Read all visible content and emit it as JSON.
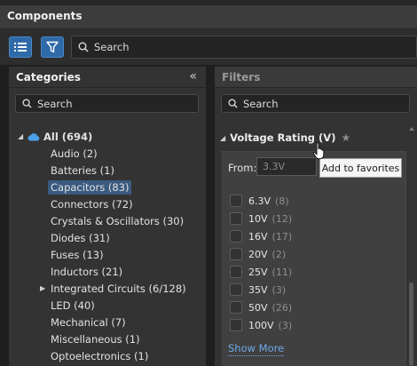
{
  "window": {
    "title": "Components"
  },
  "toolbar": {
    "list_view_icon": "list-icon",
    "filter_icon": "filter-icon",
    "search_placeholder": "Search"
  },
  "categories_panel": {
    "title": "Categories",
    "collapse_glyph": "«",
    "search_placeholder": "Search",
    "root": {
      "label": "All (694)",
      "expanded": true,
      "icon": "cloud-icon"
    },
    "items": [
      {
        "label": "Audio (2)"
      },
      {
        "label": "Batteries (1)"
      },
      {
        "label": "Capacitors (83)",
        "selected": true
      },
      {
        "label": "Connectors (72)"
      },
      {
        "label": "Crystals & Oscillators (30)"
      },
      {
        "label": "Diodes (31)"
      },
      {
        "label": "Fuses (13)"
      },
      {
        "label": "Inductors (21)"
      },
      {
        "label": "Integrated Circuits (6/128)",
        "expandable": true
      },
      {
        "label": "LED (40)"
      },
      {
        "label": "Mechanical (7)"
      },
      {
        "label": "Miscellaneous (1)"
      },
      {
        "label": "Optoelectronics (1)"
      }
    ]
  },
  "filters_panel": {
    "title": "Filters",
    "search_placeholder": "Search",
    "section": {
      "title": "Voltage Rating (V)",
      "from_label": "From:",
      "from_placeholder": "3.3V",
      "tooltip": "Add to favorites",
      "options": [
        {
          "value": "6.3V",
          "count": "(8)"
        },
        {
          "value": "10V",
          "count": "(12)"
        },
        {
          "value": "16V",
          "count": "(17)"
        },
        {
          "value": "20V",
          "count": "(2)"
        },
        {
          "value": "25V",
          "count": "(11)"
        },
        {
          "value": "35V",
          "count": "(3)"
        },
        {
          "value": "50V",
          "count": "(26)"
        },
        {
          "value": "100V",
          "count": "(3)"
        }
      ],
      "show_more": "Show More"
    }
  },
  "colors": {
    "accent": "#2f6aa8",
    "selection": "#3a5a80",
    "link": "#6fa8e6",
    "cloud": "#4aa0e8"
  }
}
